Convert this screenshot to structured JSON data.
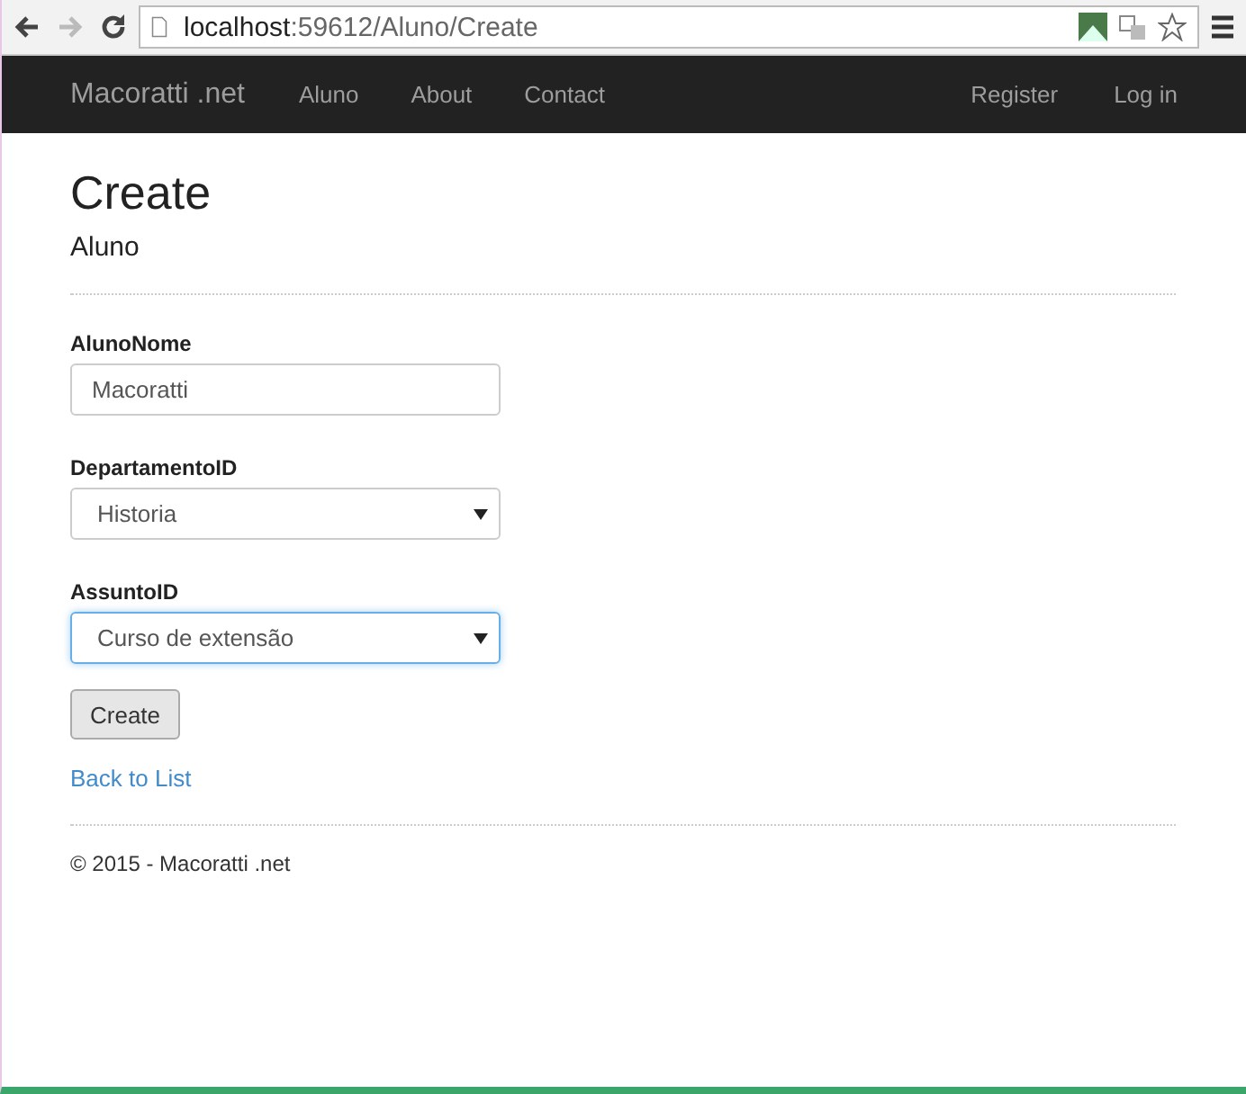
{
  "browser": {
    "back_disabled": false,
    "forward_disabled": true,
    "url_host": "localhost",
    "url_path": ":59612/Aluno/Create"
  },
  "navbar": {
    "brand": "Macoratti .net",
    "links": [
      "Aluno",
      "About",
      "Contact"
    ],
    "right_links": [
      "Register",
      "Log in"
    ]
  },
  "page": {
    "title": "Create",
    "subtitle": "Aluno"
  },
  "fields": [
    {
      "kind": "text",
      "label": "AlunoNome",
      "value": "Macoratti",
      "focused": false
    },
    {
      "kind": "select",
      "label": "DepartamentoID",
      "value": "Historia",
      "focused": false
    },
    {
      "kind": "select",
      "label": "AssuntoID",
      "value": "Curso de extensão",
      "focused": true
    }
  ],
  "submit": "Create",
  "back_link": "Back to List",
  "footer": "© 2015 - Macoratti .net"
}
